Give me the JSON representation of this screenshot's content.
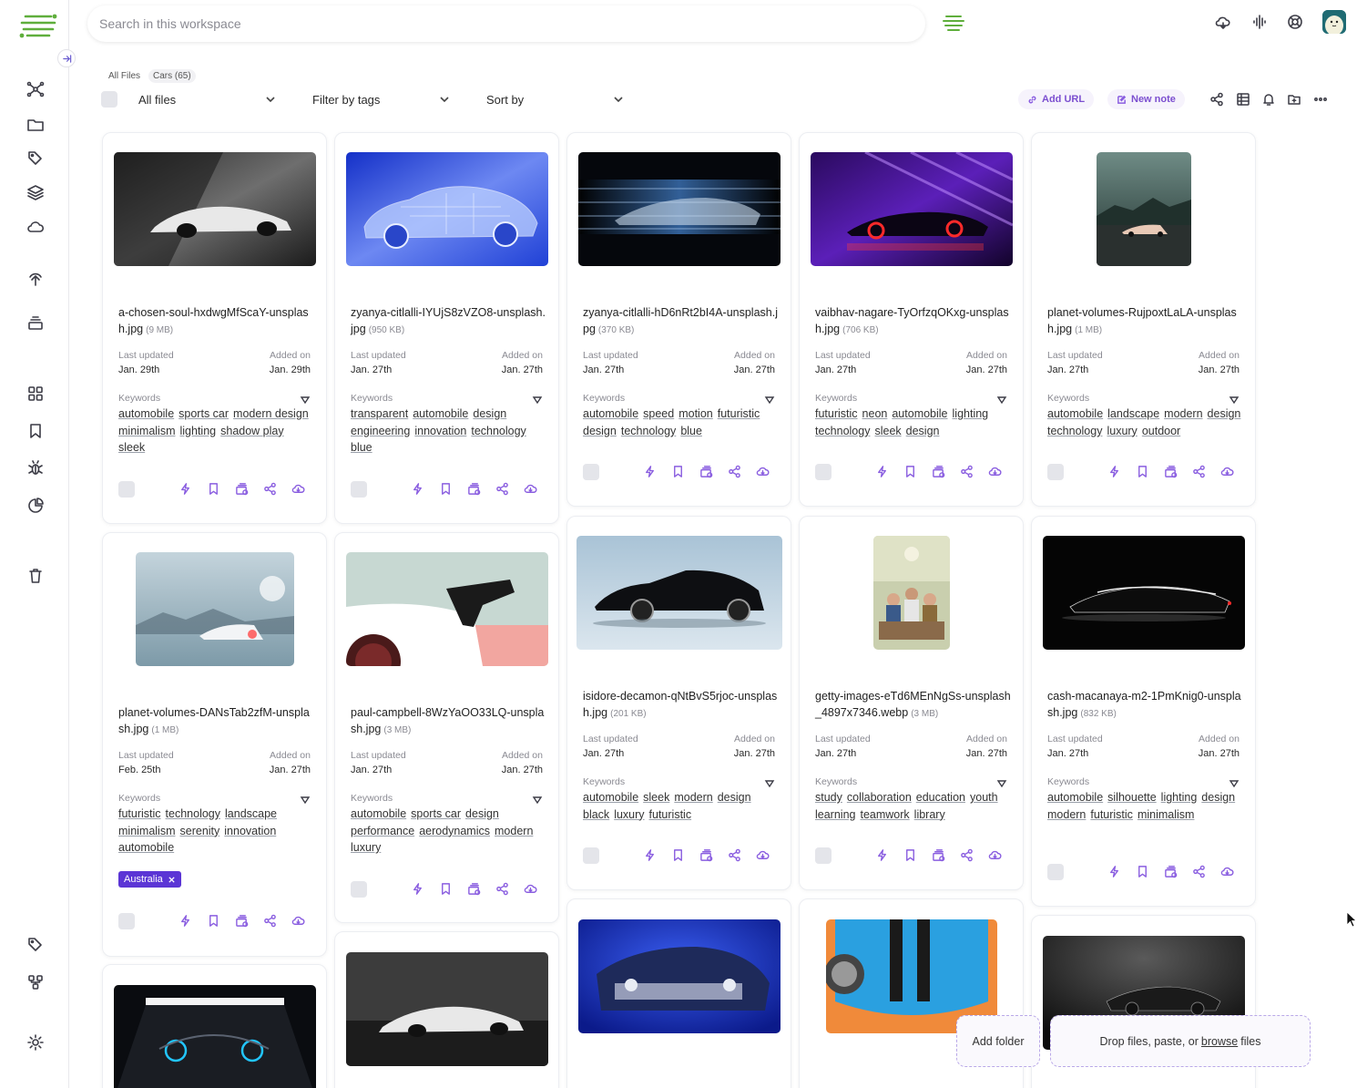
{
  "search": {
    "placeholder": "Search in this workspace"
  },
  "breadcrumb": [
    {
      "label": "All Files"
    },
    {
      "label": "Cars (65)"
    }
  ],
  "filters": {
    "type_selected": "All files",
    "tags_placeholder": "Filter by tags",
    "sort_placeholder": "Sort by"
  },
  "toolbar": {
    "add_url_label": "Add URL",
    "new_note_label": "New note"
  },
  "labels": {
    "last_updated": "Last updated",
    "added_on": "Added on",
    "keywords": "Keywords"
  },
  "cards": [
    {
      "name": "a-chosen-soul-hxdwgMfScaY-unsplash.jpg",
      "size": "(9 MB)",
      "updated": "Jan. 29th",
      "added": "Jan. 29th",
      "tags": [
        "automobile",
        "sports car",
        "modern design",
        "minimalism",
        "lighting",
        "shadow play",
        "sleek"
      ]
    },
    {
      "name": "zyanya-citlalli-IYUjS8zVZO8-unsplash.jpg",
      "size": "(950 KB)",
      "updated": "Jan. 27th",
      "added": "Jan. 27th",
      "tags": [
        "transparent",
        "automobile",
        "design",
        "engineering",
        "innovation",
        "technology",
        "blue"
      ]
    },
    {
      "name": "zyanya-citlalli-hD6nRt2bI4A-unsplash.jpg",
      "size": "(370 KB)",
      "updated": "Jan. 27th",
      "added": "Jan. 27th",
      "tags": [
        "automobile",
        "speed",
        "motion",
        "futuristic",
        "design",
        "technology",
        "blue"
      ]
    },
    {
      "name": "vaibhav-nagare-TyOrfzqOKxg-unsplash.jpg",
      "size": "(706 KB)",
      "updated": "Jan. 27th",
      "added": "Jan. 27th",
      "tags": [
        "futuristic",
        "neon",
        "automobile",
        "lighting",
        "technology",
        "sleek",
        "design"
      ]
    },
    {
      "name": "planet-volumes-RujpoxtLaLA-unsplash.jpg",
      "size": "(1 MB)",
      "updated": "Jan. 27th",
      "added": "Jan. 27th",
      "tags": [
        "automobile",
        "landscape",
        "modern",
        "design",
        "technology",
        "luxury",
        "outdoor"
      ]
    },
    {
      "name": "planet-volumes-DANsTab2zfM-unsplash.jpg",
      "size": "(1 MB)",
      "updated": "Feb. 25th",
      "added": "Jan. 27th",
      "tags": [
        "futuristic",
        "technology",
        "landscape",
        "minimalism",
        "serenity",
        "innovation",
        "automobile"
      ],
      "chip": "Australia"
    },
    {
      "name": "paul-campbell-8WzYaOO33LQ-unsplash.jpg",
      "size": "(3 MB)",
      "updated": "Jan. 27th",
      "added": "Jan. 27th",
      "tags": [
        "automobile",
        "sports car",
        "design",
        "performance",
        "aerodynamics",
        "modern",
        "luxury"
      ]
    },
    {
      "name": "isidore-decamon-qNtBvS5rjoc-unsplash.jpg",
      "size": "(201 KB)",
      "updated": "Jan. 27th",
      "added": "Jan. 27th",
      "tags": [
        "automobile",
        "sleek",
        "modern",
        "design",
        "black",
        "luxury",
        "futuristic"
      ]
    },
    {
      "name": "getty-images-eTd6MEnNgSs-unsplash_4897x7346.webp",
      "size": "(3 MB)",
      "updated": "Jan. 27th",
      "added": "Jan. 27th",
      "tags": [
        "study",
        "collaboration",
        "education",
        "youth",
        "learning",
        "teamwork",
        "library"
      ]
    },
    {
      "name": "cash-macanaya-m2-1PmKnig0-unsplash.jpg",
      "size": "(832 KB)",
      "updated": "Jan. 27th",
      "added": "Jan. 27th",
      "tags": [
        "automobile",
        "silhouette",
        "lighting",
        "design",
        "modern",
        "futuristic",
        "minimalism"
      ]
    }
  ],
  "bottom": {
    "add_folder": "Add folder",
    "drop_prefix": "Drop files, paste, or",
    "browse": "browse",
    "drop_suffix": "files"
  },
  "colors": {
    "accent": "#5b35d5",
    "action_icon": "#8a5ee0",
    "logo_green": "#5fae3c"
  }
}
